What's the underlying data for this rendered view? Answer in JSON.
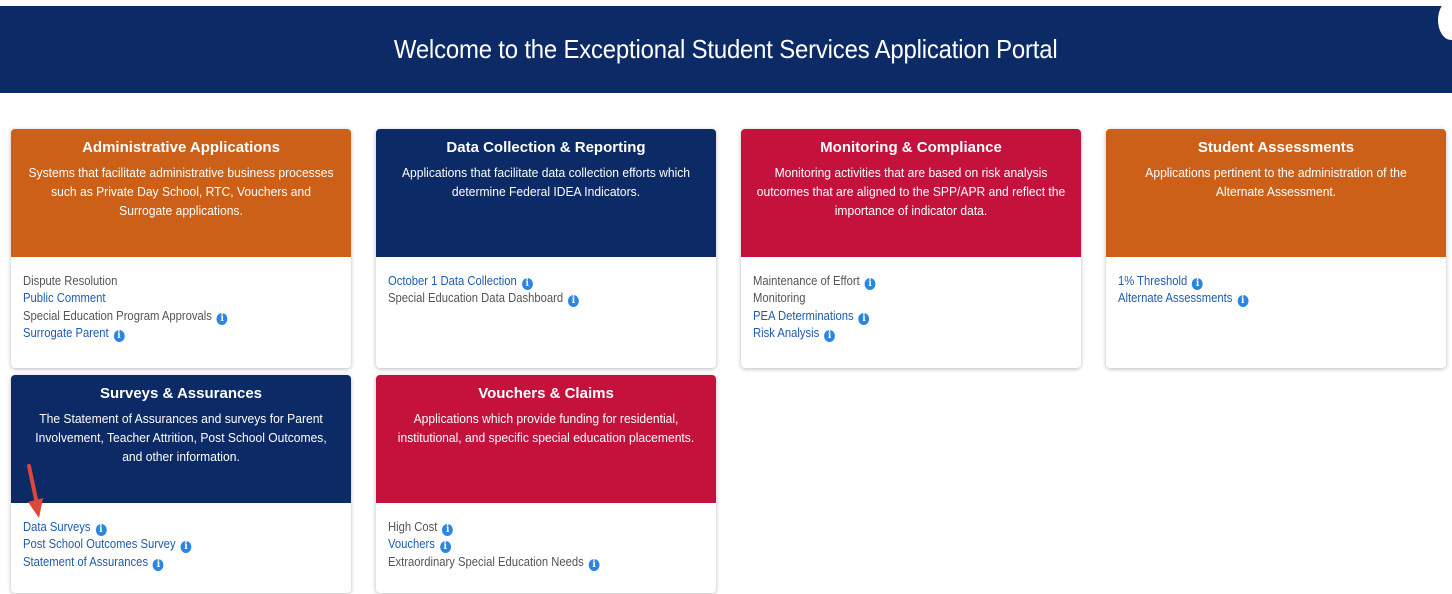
{
  "header": {
    "title": "Welcome to the Exceptional Student Services Application Portal"
  },
  "colors": {
    "orange": "#cc6018",
    "navy": "#0c2a66",
    "crimson": "#c4123d",
    "link": "#1f5bb0",
    "info": "#2a86e0",
    "arrow": "#e2453a"
  },
  "cards": [
    {
      "title": "Administrative Applications",
      "description": "Systems that facilitate administrative business processes such as Private Day School, RTC, Vouchers and Surrogate applications.",
      "links": [
        {
          "label": "Dispute Resolution",
          "link": false,
          "info": false
        },
        {
          "label": "Public Comment",
          "link": true,
          "info": false
        },
        {
          "label": "Special Education Program Approvals",
          "link": false,
          "info": true
        },
        {
          "label": "Surrogate Parent",
          "link": true,
          "info": true
        }
      ]
    },
    {
      "title": "Data Collection & Reporting",
      "description": "Applications that facilitate data collection efforts which determine Federal IDEA Indicators.",
      "links": [
        {
          "label": "October 1 Data Collection",
          "link": true,
          "info": true
        },
        {
          "label": "Special Education Data Dashboard",
          "link": false,
          "info": true
        }
      ]
    },
    {
      "title": "Monitoring & Compliance",
      "description": "Monitoring activities that are based on risk analysis outcomes that are aligned to the SPP/APR and reflect the importance of indicator data.",
      "links": [
        {
          "label": "Maintenance of Effort",
          "link": false,
          "info": true
        },
        {
          "label": "Monitoring",
          "link": false,
          "info": false
        },
        {
          "label": "PEA Determinations",
          "link": true,
          "info": true
        },
        {
          "label": "Risk Analysis",
          "link": true,
          "info": true
        }
      ]
    },
    {
      "title": "Student Assessments",
      "description": "Applications pertinent to the administration of the Alternate Assessment.",
      "links": [
        {
          "label": "1% Threshold",
          "link": true,
          "info": true
        },
        {
          "label": "Alternate Assessments",
          "link": true,
          "info": true
        }
      ]
    },
    {
      "title": "Surveys & Assurances",
      "description": "The Statement of Assurances and surveys for Parent Involvement, Teacher Attrition, Post School Outcomes, and other information.",
      "links": [
        {
          "label": "Data Surveys",
          "link": true,
          "info": true
        },
        {
          "label": "Post School Outcomes Survey",
          "link": true,
          "info": true
        },
        {
          "label": "Statement of Assurances",
          "link": true,
          "info": true
        }
      ]
    },
    {
      "title": "Vouchers & Claims",
      "description": "Applications which provide funding for residential, institutional, and specific special education placements.",
      "links": [
        {
          "label": "High Cost",
          "link": false,
          "info": true
        },
        {
          "label": "Vouchers",
          "link": true,
          "info": true
        },
        {
          "label": "Extraordinary Special Education Needs",
          "link": false,
          "info": true
        }
      ]
    }
  ],
  "info_glyph": "i"
}
